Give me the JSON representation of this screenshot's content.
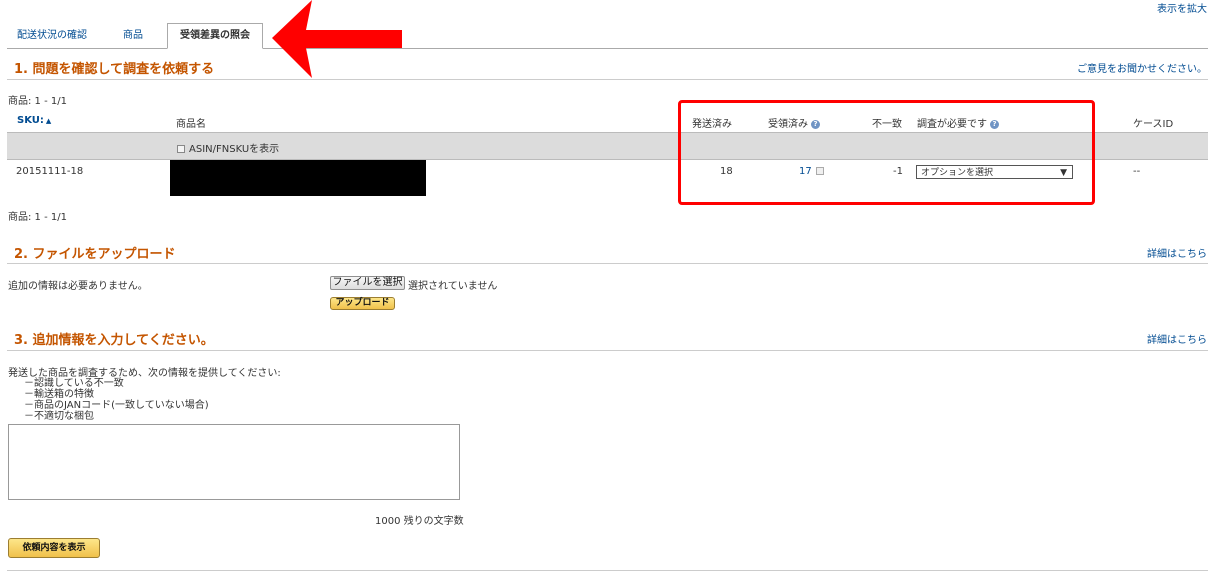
{
  "header": {
    "zoom_link": "表示を拡大"
  },
  "tabs": [
    {
      "label": "配送状況の確認"
    },
    {
      "label": "商品"
    },
    {
      "label": "受領差異の照会"
    }
  ],
  "section1": {
    "title": "1. 問題を確認して調査を依頼する",
    "feedback_link": "ご意見をお聞かせください。",
    "pagination_top": "商品: 1 - 1/1",
    "pagination_bottom": "商品: 1 - 1/1",
    "table": {
      "columns": {
        "sku": "SKU:",
        "product_name": "商品名",
        "shipped": "発送済み",
        "received": "受領済み",
        "discrepancy": "不一致",
        "investigation": "調査が必要です",
        "case_id": "ケースID"
      },
      "asin_toggle_label": "ASIN/FNSKUを表示",
      "rows": [
        {
          "sku": "20151111-18",
          "shipped": "18",
          "received": "17",
          "discrepancy": "-1",
          "investigation_selected": "オプションを選択",
          "case_id": "--"
        }
      ]
    }
  },
  "section2": {
    "title": "2. ファイルをアップロード",
    "details_link": "詳細はこちら",
    "note": "追加の情報は必要ありません。",
    "choose_file_label": "ファイルを選択",
    "no_file_text": "選択されていません",
    "upload_button": "アップロード"
  },
  "section3": {
    "title": "3. 追加情報を入力してください。",
    "details_link": "詳細はこちら",
    "instructions": "発送した商品を調査するため、次の情報を提供してください:",
    "bullets": [
      "－認識している不一致",
      "－輸送箱の特徴",
      "－商品のJANコード(一致していない場合)",
      "－不適切な梱包"
    ],
    "char_count": "1000 残りの文字数",
    "submit_button": "依頼内容を表示"
  },
  "colors": {
    "section_title": "#c45500",
    "link": "#004b91",
    "annotation_red": "#ff0000",
    "header_row_bg": "#dcdcdc"
  }
}
